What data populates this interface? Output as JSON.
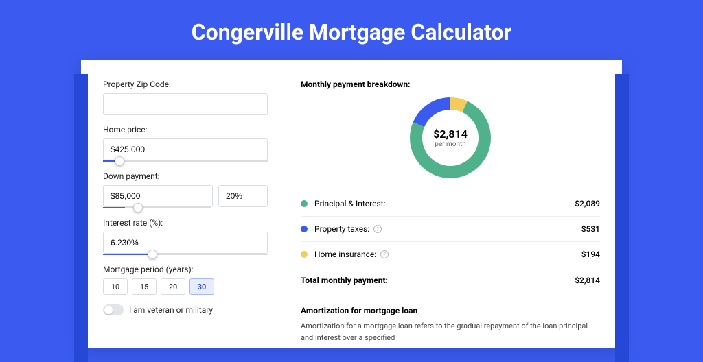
{
  "title": "Congerville Mortgage Calculator",
  "form": {
    "zip_label": "Property Zip Code:",
    "zip_value": "",
    "home_price_label": "Home price:",
    "home_price_value": "$425,000",
    "home_price_slider_pct": 10,
    "down_payment_label": "Down payment:",
    "down_payment_value": "$85,000",
    "down_payment_pct": "20%",
    "down_payment_slider_pct": 20,
    "interest_label": "Interest rate (%):",
    "interest_value": "6.230%",
    "interest_slider_pct": 30,
    "period_label": "Mortgage period (years):",
    "periods": [
      "10",
      "15",
      "20",
      "30"
    ],
    "period_active": "30",
    "veteran_label": "I am veteran or military"
  },
  "breakdown": {
    "title": "Monthly payment breakdown:",
    "center_value": "$2,814",
    "center_sub": "per month",
    "rows": [
      {
        "label": "Principal & Interest:",
        "value": "$2,089",
        "color": "green",
        "info": false
      },
      {
        "label": "Property taxes:",
        "value": "$531",
        "color": "blue",
        "info": true
      },
      {
        "label": "Home insurance:",
        "value": "$194",
        "color": "yellow",
        "info": true
      }
    ],
    "total_label": "Total monthly payment:",
    "total_value": "$2,814"
  },
  "amort": {
    "title": "Amortization for mortgage loan",
    "text": "Amortization for a mortgage loan refers to the gradual repayment of the loan principal and interest over a specified"
  },
  "chart_data": {
    "type": "pie",
    "title": "Monthly payment breakdown",
    "series": [
      {
        "name": "Principal & Interest",
        "value": 2089,
        "color": "#4fb28a"
      },
      {
        "name": "Property taxes",
        "value": 531,
        "color": "#3b5bf0"
      },
      {
        "name": "Home insurance",
        "value": 194,
        "color": "#f2cd5c"
      }
    ],
    "total": 2814,
    "center_label": "$2,814 per month"
  }
}
